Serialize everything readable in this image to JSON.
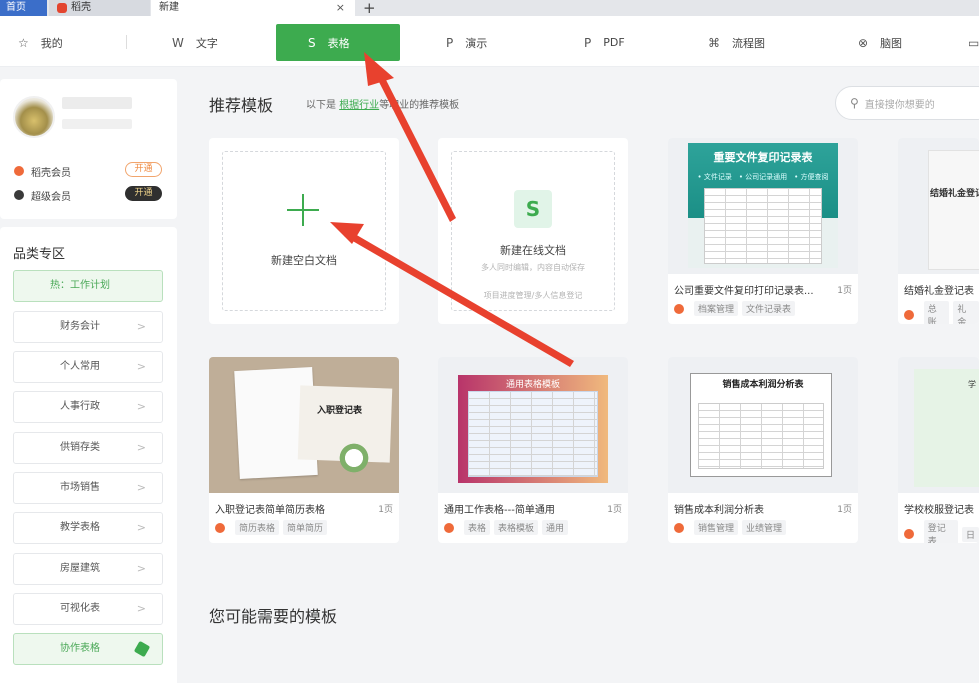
{
  "tabs": {
    "home": "首页",
    "daoke": "稻壳",
    "new": "新建",
    "add": "+",
    "close": "×"
  },
  "categories": [
    {
      "label": "我的",
      "icon": "☆"
    },
    {
      "label": "文字",
      "icon": "W"
    },
    {
      "label": "表格",
      "icon": "S",
      "active": true
    },
    {
      "label": "演示",
      "icon": "P"
    },
    {
      "label": "PDF",
      "icon": "P"
    },
    {
      "label": "流程图",
      "icon": "⌘"
    },
    {
      "label": "脑图",
      "icon": "⊗"
    }
  ],
  "membership": {
    "daoke_member": "稻壳会员",
    "super_member": "超级会员",
    "open_btn_1": "开通",
    "open_btn_2": "开通"
  },
  "sidebar": {
    "title": "品类专区",
    "hot": "热：工作计划",
    "items": [
      "财务会计",
      "个人常用",
      "人事行政",
      "供销存类",
      "市场销售",
      "教学表格",
      "房屋建筑",
      "可视化表"
    ],
    "collab": "协作表格"
  },
  "main": {
    "section_title": "推荐模板",
    "sub_prefix": "以下是",
    "sub_link": "根据行业",
    "sub_suffix": "等职业的推荐模板",
    "search_placeholder": "直接搜你想要的",
    "bottom_title": "您可能需要的模板"
  },
  "new_blank": {
    "label": "新建空白文档"
  },
  "new_online": {
    "label": "新建在线文档",
    "sub1": "多人同时编辑，内容自动保存",
    "sub2": "项目进度管理/多人信息登记"
  },
  "templates": [
    {
      "title": "公司重要文件复印打印记录表...",
      "pages": "1页",
      "tags": [
        "档案管理",
        "文件记录表"
      ],
      "thumb_title": "重要文件复印记录表",
      "thumb_sub": "• 文件记录　• 公司记录通用　• 方便查阅"
    },
    {
      "title": "结婚礼金登记表",
      "pages": "",
      "tags": [
        "总账",
        "礼金"
      ],
      "thumb_title": "结婚礼金登记表"
    },
    {
      "title": "入职登记表简单简历表格",
      "pages": "1页",
      "tags": [
        "简历表格",
        "简单简历"
      ],
      "thumb_title": "入职登记表"
    },
    {
      "title": "通用工作表格---简单通用",
      "pages": "1页",
      "tags": [
        "表格",
        "表格模板",
        "通用"
      ],
      "thumb_title": "通用表格模板"
    },
    {
      "title": "销售成本利润分析表",
      "pages": "1页",
      "tags": [
        "销售管理",
        "业绩管理"
      ],
      "thumb_title": "销售成本利润分析表"
    },
    {
      "title": "学校校服登记表",
      "pages": "",
      "tags": [
        "登记表",
        "日"
      ],
      "thumb_title": "学"
    }
  ],
  "colors": {
    "accent": "#3dab4f",
    "arrow": "#e8412e",
    "tab_home": "#3b6ec9"
  }
}
